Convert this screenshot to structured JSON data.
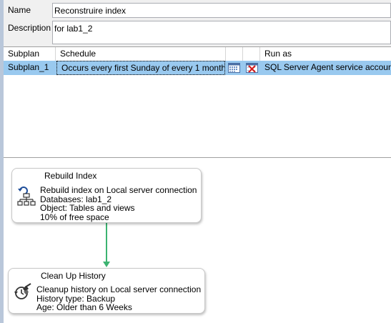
{
  "form": {
    "name_label": "Name",
    "name_value": "Reconstruire index",
    "description_label": "Description",
    "description_value": "for lab1_2"
  },
  "grid": {
    "headers": {
      "subplan": "Subplan",
      "schedule": "Schedule",
      "run_as": "Run as"
    },
    "rows": [
      {
        "subplan": "Subplan_1",
        "schedule": "Occurs every first Sunday of every 1 month(s...",
        "run_as": "SQL Server Agent service account"
      }
    ],
    "selection_color": "#99c9ef"
  },
  "tasks": [
    {
      "title": "Rebuild Index",
      "icon": "rebuild-index-icon",
      "lines": [
        "Rebuild index on Local server connection",
        "Databases: lab1_2",
        "Object: Tables and views",
        "10% of free space"
      ]
    },
    {
      "title": "Clean Up History",
      "icon": "cleanup-history-icon",
      "lines": [
        "Cleanup history on Local server connection",
        "History type: Backup",
        "Age: Older than 6 Weeks"
      ]
    }
  ],
  "connector_color": "#3cb371"
}
